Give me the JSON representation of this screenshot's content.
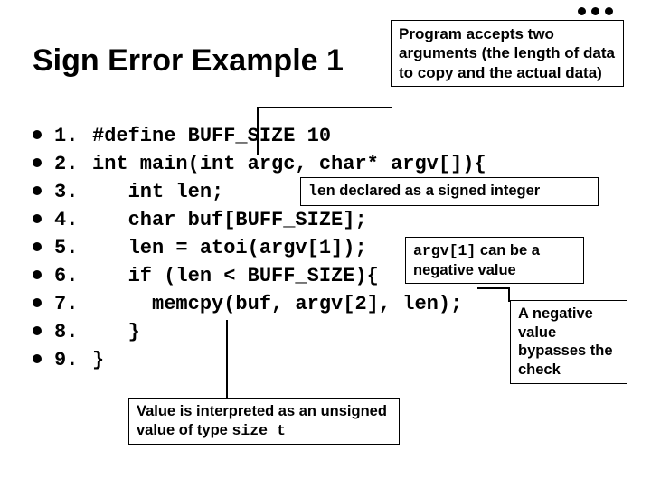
{
  "title": "Sign Error Example 1",
  "callouts": {
    "c1": "Program accepts two arguments (the length of data to copy and the actual data)",
    "c2_pre": "len",
    "c2_post": " declared as a signed integer",
    "c3_pre": "argv[1]",
    "c3_post": " can be a negative value",
    "c4": "A negative value bypasses the check",
    "c5_pre": "Value is interpreted as an unsigned value of type ",
    "c5_post": "size_t"
  },
  "code": [
    {
      "n": "1.",
      "t": "#define BUFF_SIZE 10"
    },
    {
      "n": "2.",
      "t": "int main(int argc, char* argv[]){"
    },
    {
      "n": "3.",
      "t": "   int len;"
    },
    {
      "n": "4.",
      "t": "   char buf[BUFF_SIZE];"
    },
    {
      "n": "5.",
      "t": "   len = atoi(argv[1]);"
    },
    {
      "n": "6.",
      "t": "   if (len < BUFF_SIZE){"
    },
    {
      "n": "7.",
      "t": "     memcpy(buf, argv[2], len);"
    },
    {
      "n": "8.",
      "t": "   }"
    },
    {
      "n": "9.",
      "t": "}"
    }
  ]
}
